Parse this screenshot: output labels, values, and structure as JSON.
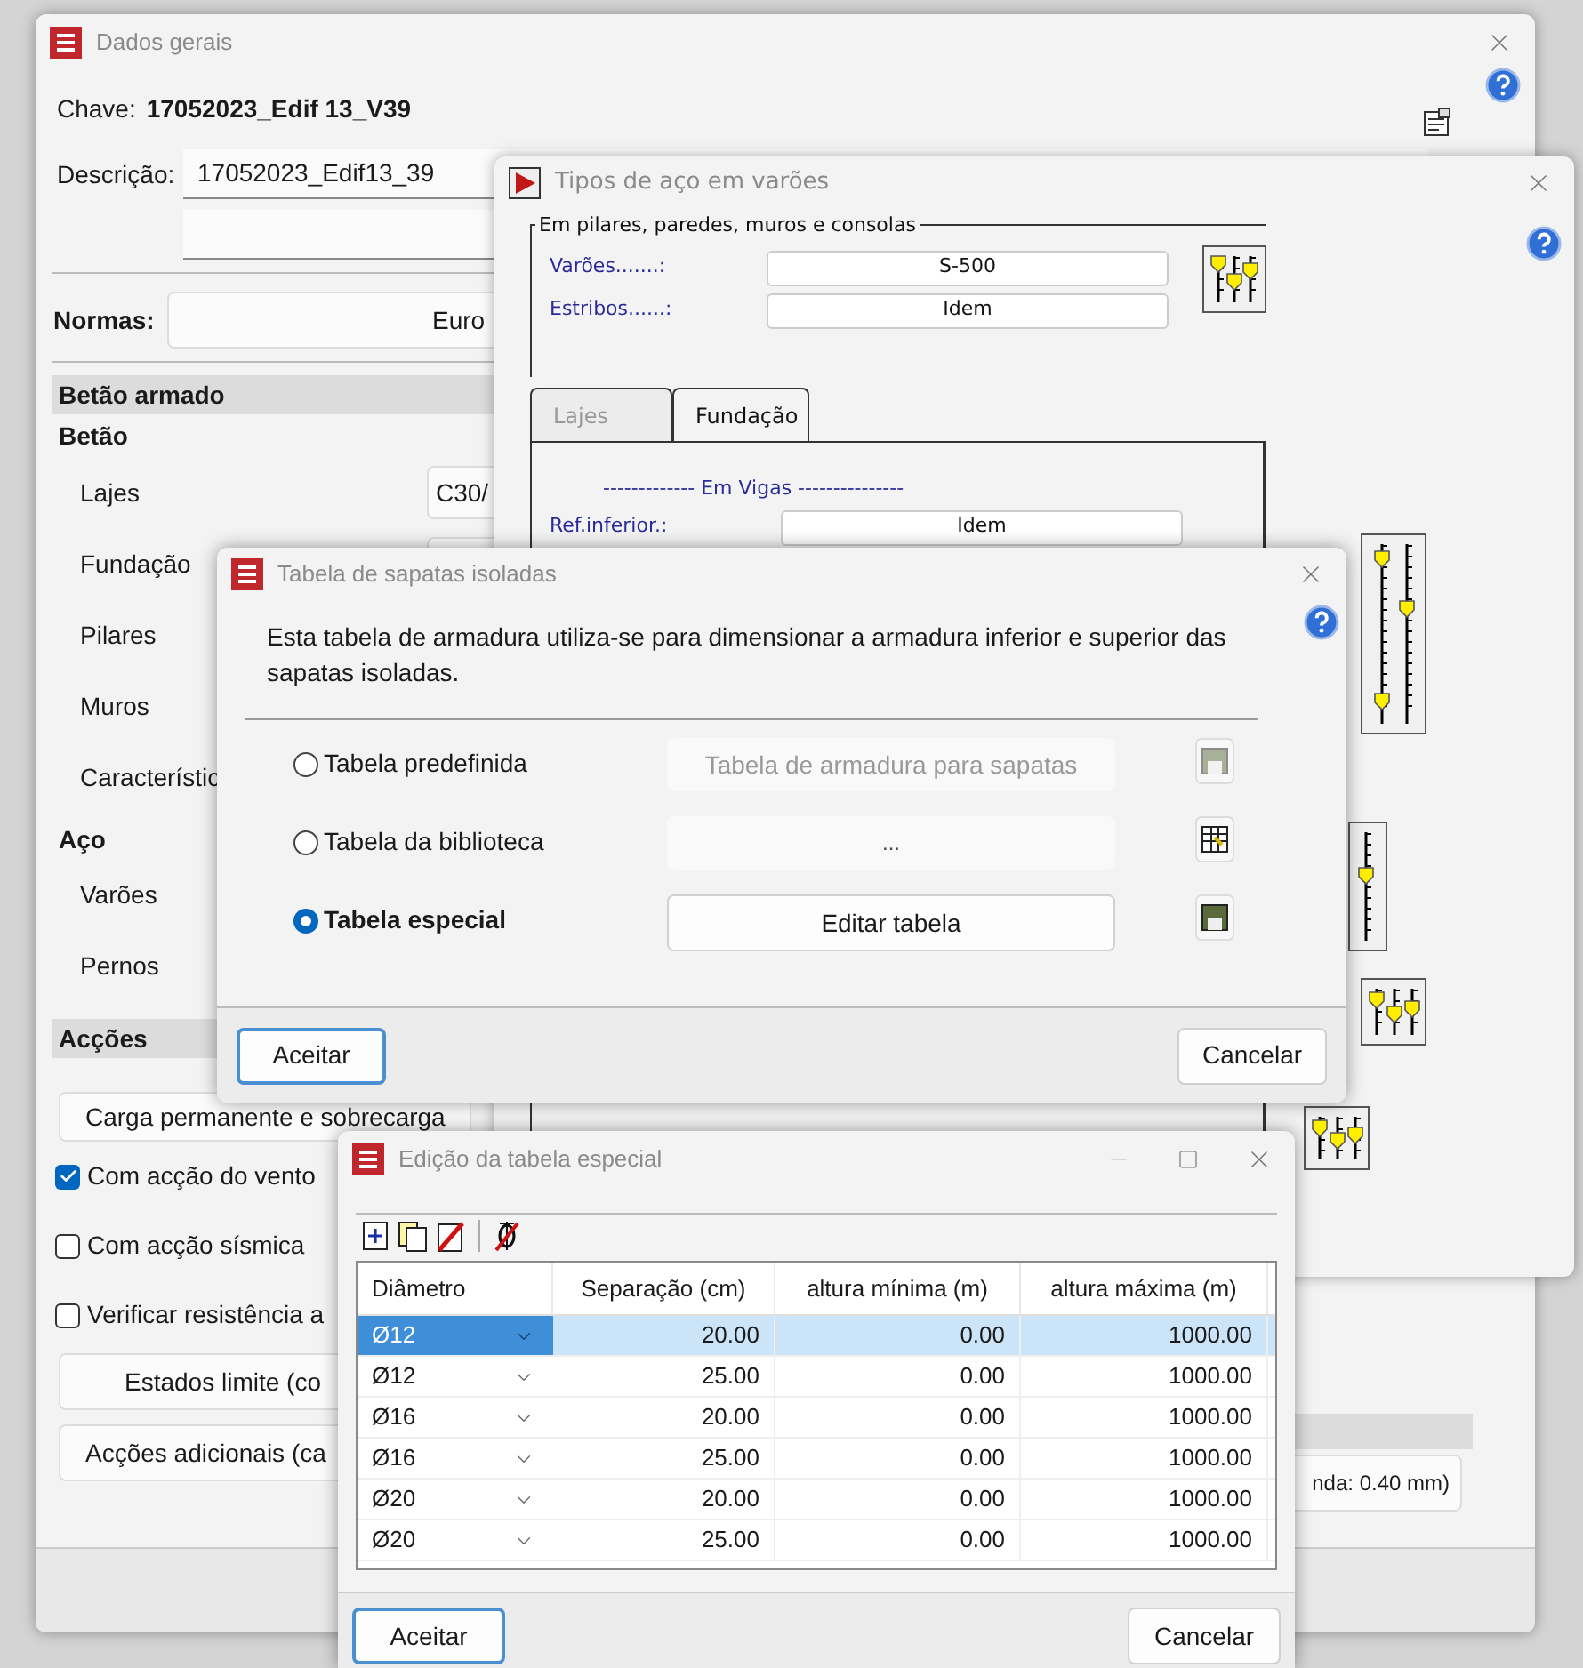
{
  "dados_gerais": {
    "title": "Dados gerais",
    "chave_label": "Chave:",
    "chave_value": "17052023_Edif 13_V39",
    "descricao_label": "Descrição:",
    "descricao_value": "17052023_Edif13_39",
    "normas_label": "Normas:",
    "normas_value": "Euro",
    "section_title": "Betão armado",
    "betao_heading": "Betão",
    "betao_rows": [
      {
        "label": "Lajes",
        "value": "C30/"
      },
      {
        "label": "Fundação",
        "value": ""
      },
      {
        "label": "Pilares"
      },
      {
        "label": "Muros"
      },
      {
        "label": "Característic"
      }
    ],
    "aco_heading": "Aço",
    "aco_rows": [
      {
        "label": "Varões"
      },
      {
        "label": "Pernos"
      }
    ],
    "accoes_heading": "Acções",
    "carga_button": "Carga permanente e sobrecarga",
    "checkboxes": [
      {
        "label": "Com acção do vento",
        "checked": true
      },
      {
        "label": "Com acção sísmica",
        "checked": false
      },
      {
        "label": "Verificar resistência a",
        "checked": false
      }
    ],
    "estados_button": "Estados limite (co",
    "adicionais_button": "Acções adicionais (ca",
    "fissura_button": "nda: 0.40 mm)"
  },
  "tipos_aco": {
    "title": "Tipos de aço em varões",
    "group_title": "Em pilares, paredes, muros e consolas",
    "rows": [
      {
        "label": "Varões.......:",
        "value": "S-500"
      },
      {
        "label": "Estribos......:",
        "value": "Idem"
      }
    ],
    "tabs": [
      {
        "label": "Lajes",
        "selected": false
      },
      {
        "label": "Fundação",
        "selected": true
      }
    ],
    "vigas_heading": "------------- Em Vigas ---------------",
    "vigas_rows": [
      {
        "label": "Ref.inferior.:",
        "value": "Idem"
      }
    ]
  },
  "sapatas": {
    "title": "Tabela de sapatas isoladas",
    "description": "Esta tabela de armadura utiliza-se para dimensionar a armadura inferior e superior das sapatas isoladas.",
    "options": [
      {
        "label": "Tabela predefinida",
        "selected": false,
        "kind": "field",
        "disabled": true,
        "value": "Tabela de armadura para sapatas"
      },
      {
        "label": "Tabela da biblioteca",
        "selected": false,
        "kind": "field",
        "disabled": false,
        "value": "..."
      },
      {
        "label": "Tabela especial",
        "selected": true,
        "kind": "button",
        "disabled": false,
        "value": "Editar tabela"
      }
    ],
    "accept": "Aceitar",
    "cancel": "Cancelar"
  },
  "edicao": {
    "title": "Edição da tabela especial",
    "columns": [
      "Diâmetro",
      "Separação (cm)",
      "altura mínima (m)",
      "altura máxima (m)"
    ],
    "rows": [
      {
        "cells": [
          "Ø12",
          "20.00",
          "0.00",
          "1000.00"
        ],
        "selected": true
      },
      {
        "cells": [
          "Ø12",
          "25.00",
          "0.00",
          "1000.00"
        ],
        "selected": false
      },
      {
        "cells": [
          "Ø16",
          "20.00",
          "0.00",
          "1000.00"
        ],
        "selected": false
      },
      {
        "cells": [
          "Ø16",
          "25.00",
          "0.00",
          "1000.00"
        ],
        "selected": false
      },
      {
        "cells": [
          "Ø20",
          "20.00",
          "0.00",
          "1000.00"
        ],
        "selected": false
      },
      {
        "cells": [
          "Ø20",
          "25.00",
          "0.00",
          "1000.00"
        ],
        "selected": false
      }
    ],
    "accept": "Aceitar",
    "cancel": "Cancelar"
  }
}
